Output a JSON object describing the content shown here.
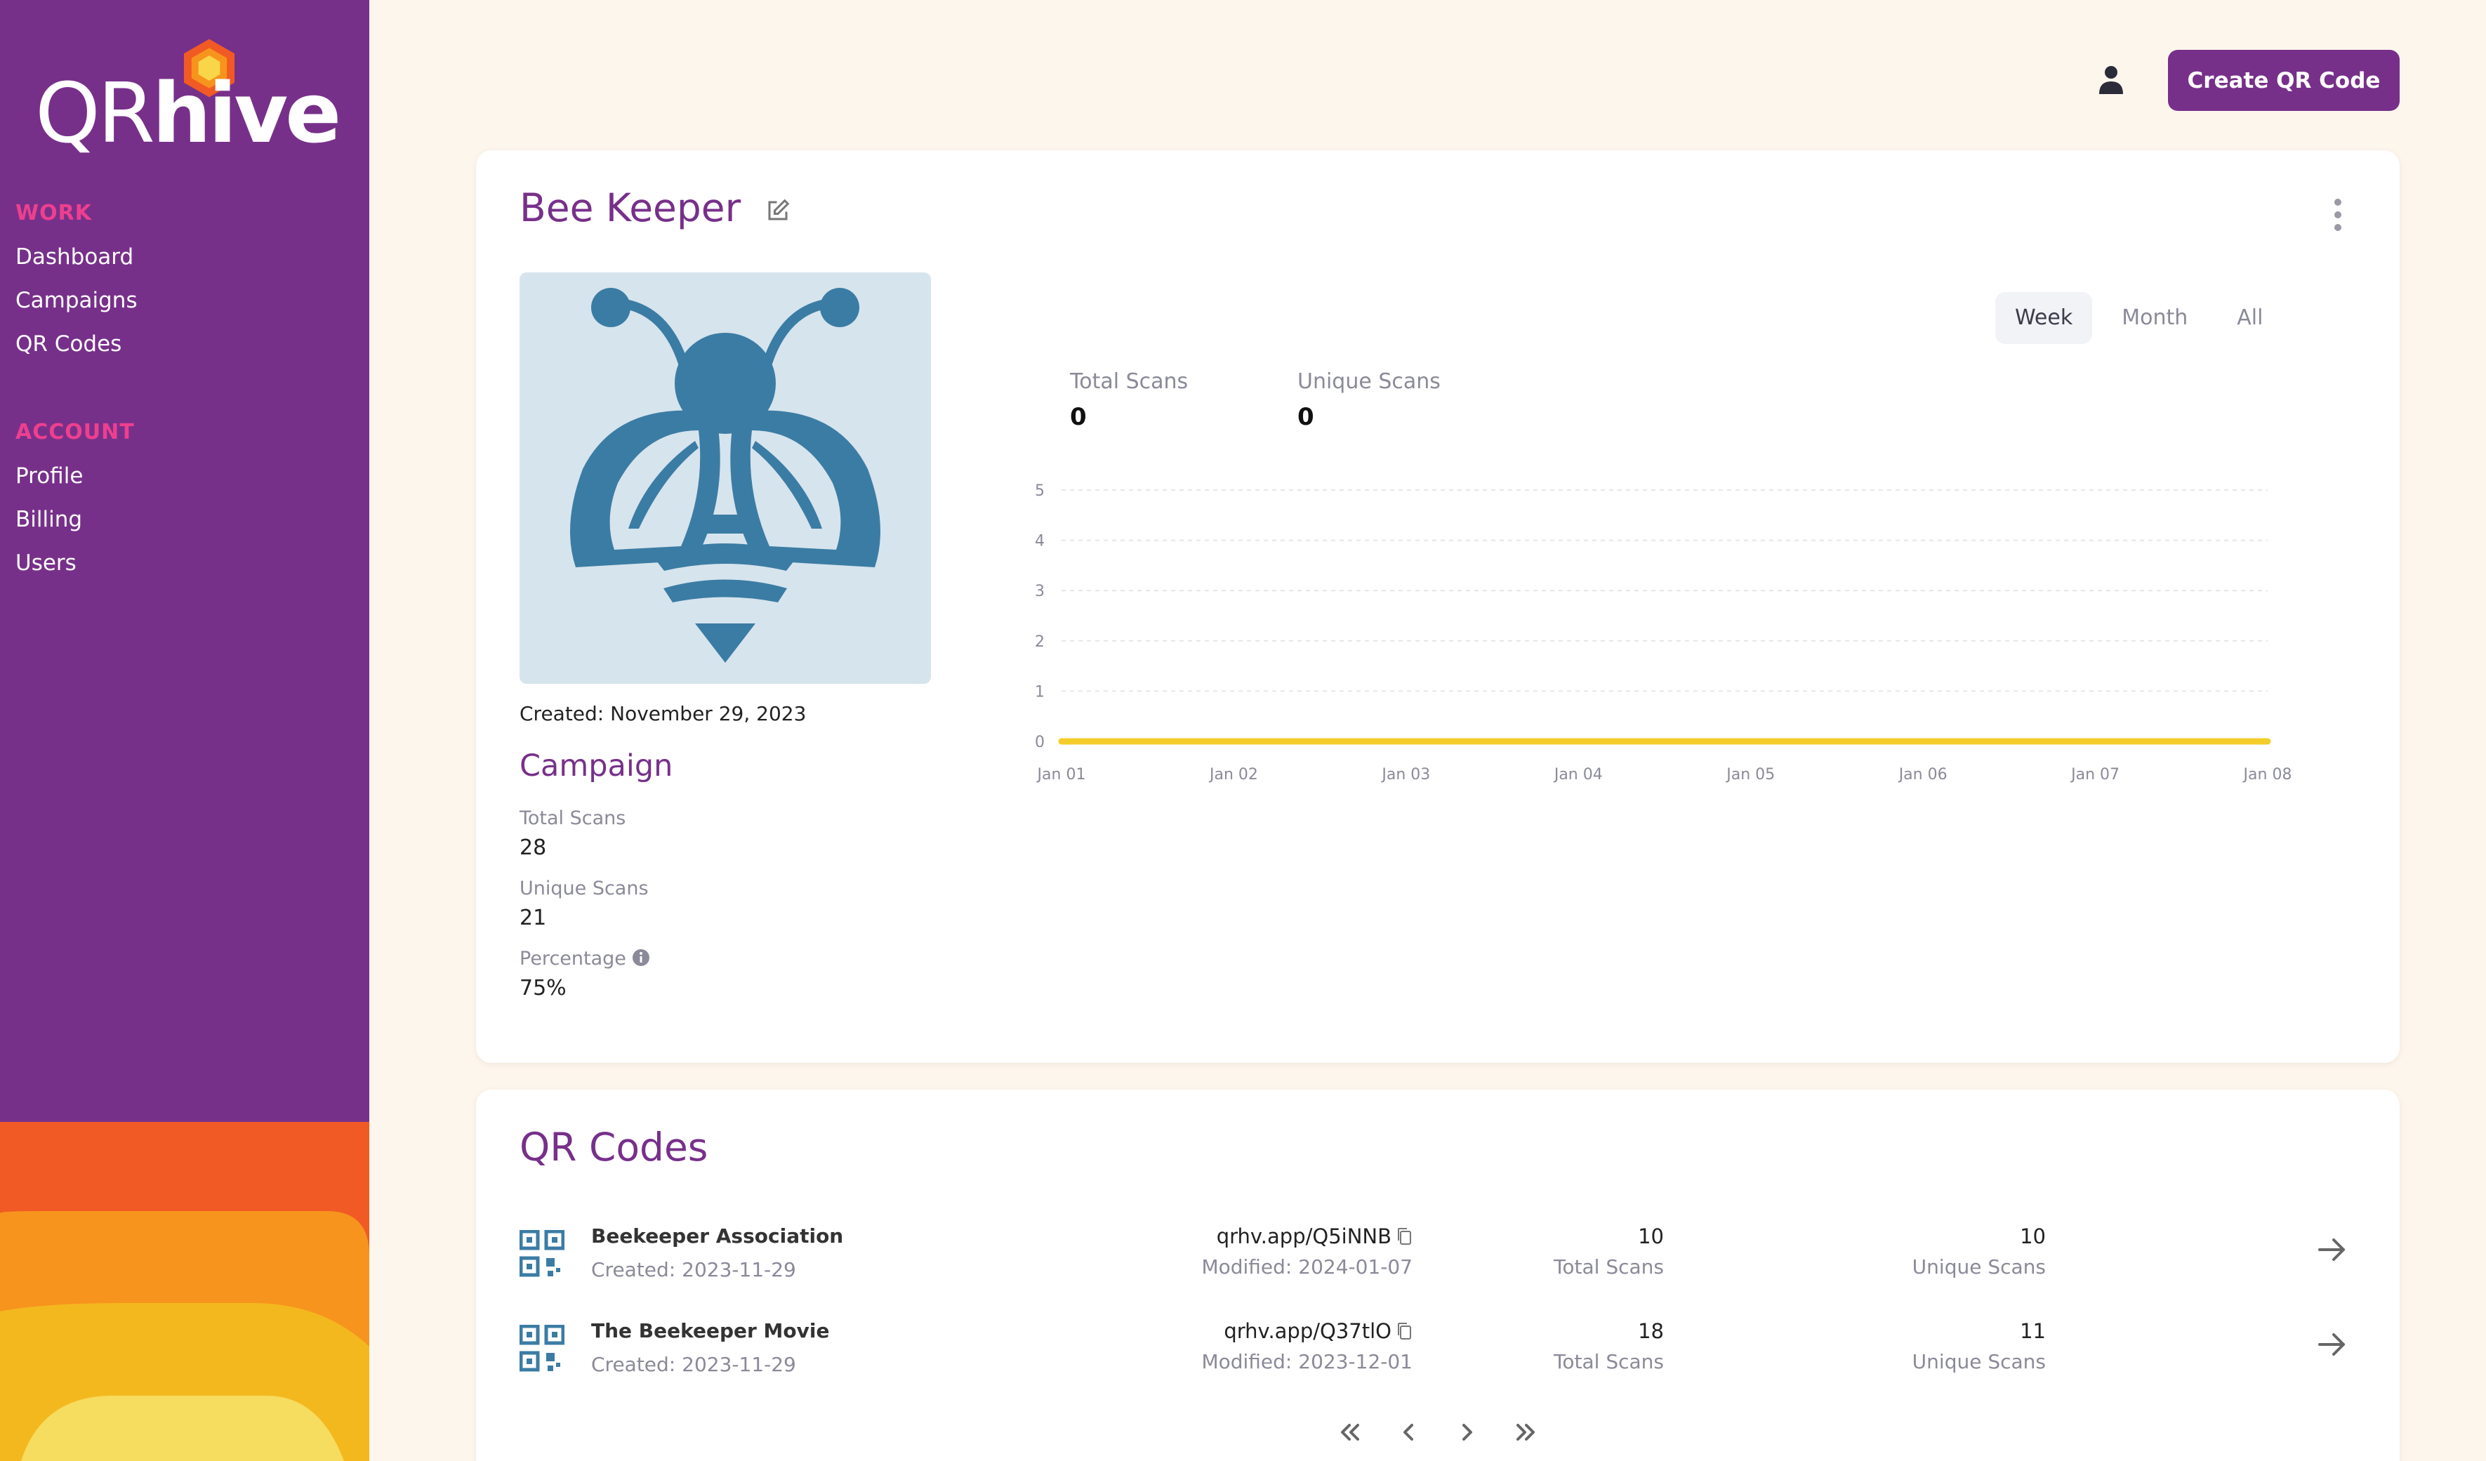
{
  "brand": {
    "logo_light": "QR",
    "logo_bold": "hive",
    "accent": "#77308a",
    "pink": "#ee3f8f"
  },
  "sidebar": {
    "sections": [
      {
        "heading": "WORK",
        "items": [
          {
            "label": "Dashboard"
          },
          {
            "label": "Campaigns"
          },
          {
            "label": "QR Codes"
          }
        ]
      },
      {
        "heading": "ACCOUNT",
        "items": [
          {
            "label": "Profile"
          },
          {
            "label": "Billing"
          },
          {
            "label": "Users"
          }
        ]
      }
    ]
  },
  "header": {
    "create_button": "Create QR Code",
    "user_icon": "user-icon"
  },
  "detail": {
    "title": "Bee Keeper",
    "created": "Created: November 29, 2023",
    "campaign_title": "Campaign",
    "stats": [
      {
        "label": "Total Scans",
        "value": "28"
      },
      {
        "label": "Unique Scans",
        "value": "21"
      },
      {
        "label": "Percentage",
        "value": "75%"
      }
    ],
    "range_tabs": [
      {
        "label": "Week",
        "active": true
      },
      {
        "label": "Month"
      },
      {
        "label": "All"
      }
    ],
    "summary": [
      {
        "label": "Total Scans",
        "value": "0"
      },
      {
        "label": "Unique Scans",
        "value": "0"
      }
    ]
  },
  "chart_data": {
    "type": "line",
    "categories": [
      "Jan 01",
      "Jan 02",
      "Jan 03",
      "Jan 04",
      "Jan 05",
      "Jan 06",
      "Jan 07",
      "Jan 08"
    ],
    "series": [
      {
        "values": [
          0,
          0,
          0,
          0,
          0,
          0,
          0,
          0
        ],
        "color": "#f4cd2a"
      }
    ],
    "y_ticks": [
      "0",
      "1",
      "2",
      "3",
      "4",
      "5"
    ],
    "ylim": [
      0,
      5
    ],
    "grid": true,
    "legend": "none"
  },
  "qr_codes": {
    "title": "QR Codes",
    "rows": [
      {
        "name": "Beekeeper Association",
        "created": "Created: 2023-11-29",
        "url": "qrhv.app/Q5iNNB",
        "modified": "Modified: 2024-01-07",
        "total": "10",
        "total_label": "Total Scans",
        "unique": "10",
        "unique_label": "Unique Scans"
      },
      {
        "name": "The Beekeeper Movie",
        "created": "Created: 2023-11-29",
        "url": "qrhv.app/Q37tlO",
        "modified": "Modified: 2023-12-01",
        "total": "18",
        "total_label": "Total Scans",
        "unique": "11",
        "unique_label": "Unique Scans"
      }
    ]
  }
}
